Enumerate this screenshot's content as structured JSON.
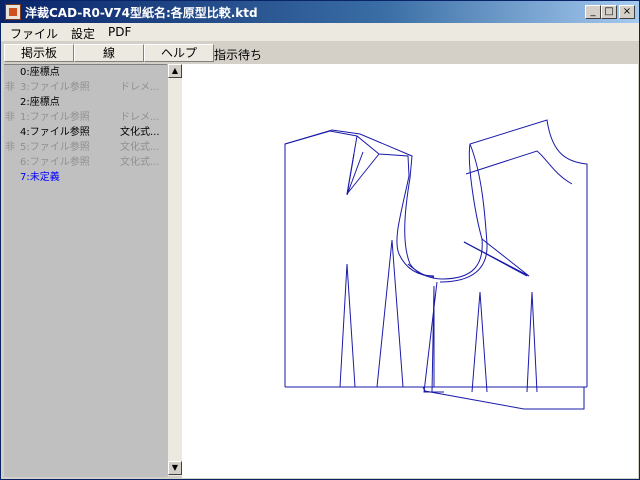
{
  "window": {
    "title": "洋裁CAD-R0-V74型紙名:各原型比較.ktd",
    "controls": {
      "minimize": "_",
      "maximize": "□",
      "close": "×"
    }
  },
  "menu": [
    "ファイル",
    "設定",
    "PDF"
  ],
  "toolbar": {
    "buttons": [
      "掲示板",
      "線",
      "ヘルプ"
    ],
    "status": "指示待ち"
  },
  "layers": [
    {
      "prefix": "",
      "name": "0:座標点",
      "detail": "",
      "color": "#000000"
    },
    {
      "prefix": "非",
      "name": "3:ファイル参照",
      "detail": "ドレメ...",
      "color": "#909090"
    },
    {
      "prefix": "",
      "name": "2:座標点",
      "detail": "",
      "color": "#000000"
    },
    {
      "prefix": "非",
      "name": "1:ファイル参照",
      "detail": "ドレメ...",
      "color": "#909090"
    },
    {
      "prefix": "",
      "name": "4:ファイル参照",
      "detail": "文化式...",
      "color": "#000000"
    },
    {
      "prefix": "非",
      "name": "5:ファイル参照",
      "detail": "文化式...",
      "color": "#909090"
    },
    {
      "prefix": "",
      "name": "6:ファイル参照",
      "detail": "文化式...",
      "color": "#909090"
    },
    {
      "prefix": "",
      "name": "7:未定義",
      "detail": "",
      "color": "#0000ff"
    }
  ],
  "scroll": {
    "up": "▲",
    "down": "▼"
  },
  "colors": {
    "pattern_line": "#1a1aaa",
    "canvas": "#ffffff"
  }
}
